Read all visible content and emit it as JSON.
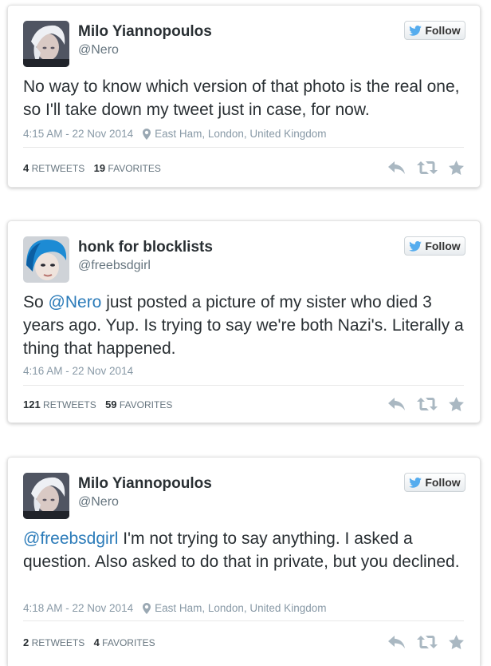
{
  "tweets": [
    {
      "name": "Milo Yiannopoulos",
      "handle": "@Nero",
      "follow_label": "Follow",
      "text_parts": {
        "before": "",
        "mention": "",
        "after": "No way to know which version of that photo is the real one, so I'll take down my tweet just in case, for now."
      },
      "time": "4:15 AM - 22 Nov 2014",
      "location": "East Ham, London, United Kingdom",
      "retweets": "4",
      "retweets_label": "RETWEETS",
      "favorites": "19",
      "favorites_label": "FAVORITES"
    },
    {
      "name": "honk for blocklists",
      "handle": "@freebsdgirl",
      "follow_label": "Follow",
      "text_parts": {
        "before": "So ",
        "mention": "@Nero",
        "after": " just posted a picture of my sister who died 3 years ago. Yup. Is trying to say we're both Nazi's. Literally a thing that happened."
      },
      "time": "4:16 AM - 22 Nov 2014",
      "location": "",
      "retweets": "121",
      "retweets_label": "RETWEETS",
      "favorites": "59",
      "favorites_label": "FAVORITES"
    },
    {
      "name": "Milo Yiannopoulos",
      "handle": "@Nero",
      "follow_label": "Follow",
      "text_parts": {
        "before": "",
        "mention": "@freebsdgirl",
        "after": " I'm not trying to say anything. I asked a question. Also asked to do that in private, but you declined."
      },
      "time": "4:18 AM - 22 Nov 2014",
      "location": "East Ham, London, United Kingdom",
      "retweets": "2",
      "retweets_label": "RETWEETS",
      "favorites": "4",
      "favorites_label": "FAVORITES"
    }
  ],
  "icons": {
    "follow": "twitter-bird-icon",
    "location": "map-pin-icon",
    "reply": "reply-icon",
    "retweet": "retweet-icon",
    "favorite": "star-icon"
  },
  "colors": {
    "link": "#2b7bb9",
    "twitter_blue": "#55acee",
    "text": "#292f33",
    "muted": "#8899a6",
    "action_icon": "#aab8c2"
  }
}
